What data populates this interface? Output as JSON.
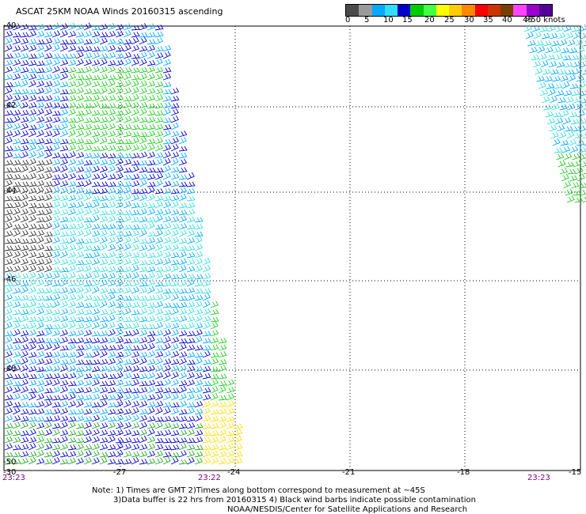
{
  "title": "ASCAT 25KM NOAA Winds 20160315 ascending",
  "legend": {
    "colors": [
      "#4a4a4a",
      "#9a9a9a",
      "#00aaff",
      "#33ddff",
      "#0000cc",
      "#00cc00",
      "#44ff44",
      "#ffff00",
      "#ffcc00",
      "#ff8800",
      "#ff0000",
      "#cc3300",
      "#7a3d00",
      "#ff44ff",
      "#9900cc",
      "#550099"
    ],
    "ticks": [
      "0",
      "5",
      "10",
      "15",
      "20",
      "25",
      "30",
      "35",
      "40",
      "45",
      ">50 knots"
    ]
  },
  "axes": {
    "lat_labels": [
      "-40",
      "-42",
      "-44",
      "-46",
      "-48",
      "-50"
    ],
    "lon_labels": [
      "-30",
      "-27",
      "-24",
      "-21",
      "-18",
      "-15"
    ]
  },
  "times": [
    "23:23",
    "23:22",
    "23:23"
  ],
  "notes": {
    "line1": "Note: 1) Times are GMT 2)Times along bottom correspond to measurement at ~45S",
    "line2": "3)Data buffer is 22 hrs from 20160315 4) Black wind barbs indicate possible contamination",
    "line3": "NOAA/NESDIS/Center for Satellite Applications and Research"
  }
}
